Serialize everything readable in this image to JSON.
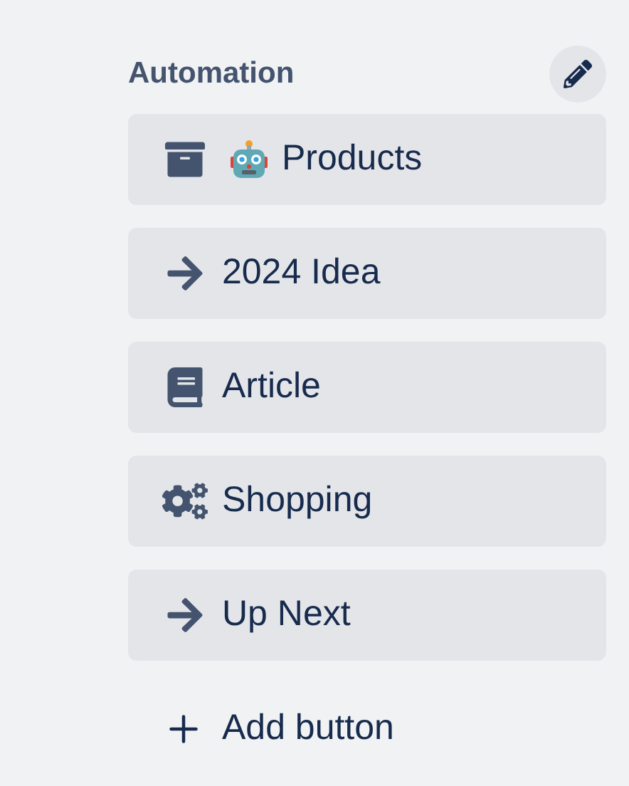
{
  "section": {
    "title": "Automation"
  },
  "buttons": [
    {
      "kind": "archive",
      "robot_badge": true,
      "label": "Products"
    },
    {
      "kind": "arrow",
      "label": "2024 Idea"
    },
    {
      "kind": "book",
      "label": "Article"
    },
    {
      "kind": "gears",
      "label": "Shopping"
    },
    {
      "kind": "arrow",
      "label": "Up Next"
    }
  ],
  "add_button": {
    "label": "Add button"
  }
}
